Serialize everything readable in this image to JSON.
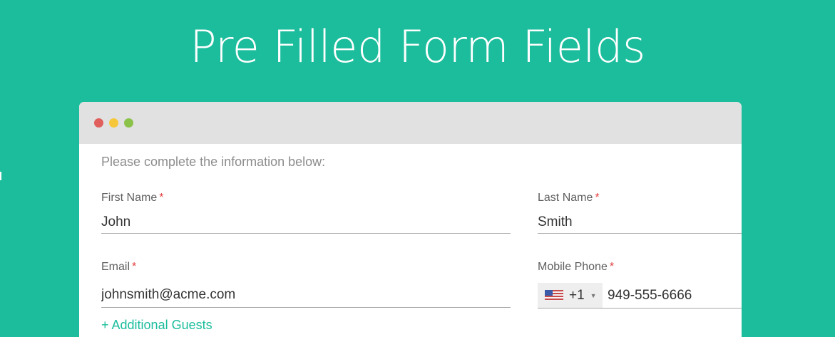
{
  "headline": "Pre Filled Form Fields",
  "window": {
    "dots": [
      {
        "name": "close",
        "color": "#e05f5c"
      },
      {
        "name": "minimize",
        "color": "#f6c73a"
      },
      {
        "name": "maximize",
        "color": "#8bc34a"
      }
    ]
  },
  "form": {
    "intro": "Please complete the information below:",
    "required_marker": "*",
    "first_name": {
      "label": "First Name",
      "value": "John"
    },
    "last_name": {
      "label": "Last Name",
      "value": "Smith"
    },
    "email": {
      "label": "Email",
      "value": "johnsmith@acme.com"
    },
    "mobile_phone": {
      "label": "Mobile Phone",
      "country_flag": "us-flag-icon",
      "dial_code": "+1",
      "value": "949-555-6666"
    },
    "additional_guests_label": "+ Additional Guests"
  },
  "colors": {
    "background": "#1bbd9c",
    "accent": "#1bbd9c",
    "required": "#e23b3b",
    "titlebar": "#e1e1e1"
  }
}
